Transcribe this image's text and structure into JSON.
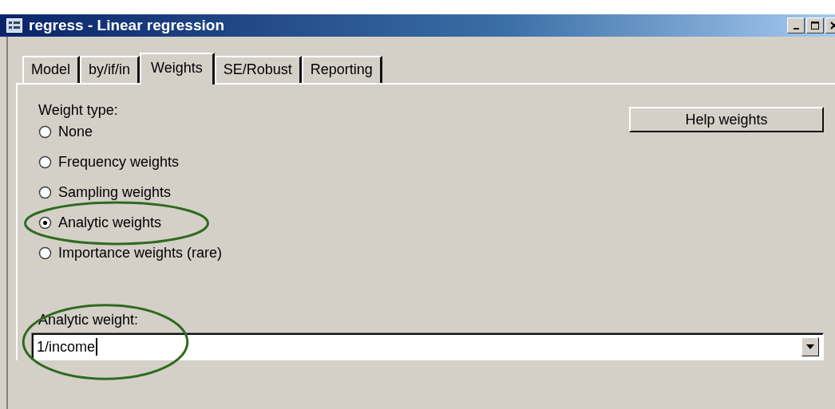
{
  "window": {
    "title": "regress - Linear regression"
  },
  "tabs": [
    {
      "label": "Model",
      "selected": false
    },
    {
      "label": "by/if/in",
      "selected": false
    },
    {
      "label": "Weights",
      "selected": true
    },
    {
      "label": "SE/Robust",
      "selected": false
    },
    {
      "label": "Reporting",
      "selected": false
    }
  ],
  "help_button": {
    "label": "Help weights"
  },
  "weight_type": {
    "label": "Weight type:",
    "options": [
      {
        "label": "None",
        "selected": false,
        "circled": false
      },
      {
        "label": "Frequency weights",
        "selected": false,
        "circled": false
      },
      {
        "label": "Sampling weights",
        "selected": false,
        "circled": false
      },
      {
        "label": "Analytic weights",
        "selected": true,
        "circled": true
      },
      {
        "label": "Importance weights (rare)",
        "selected": false,
        "circled": false
      }
    ]
  },
  "weight_field": {
    "label": "Analytic weight:",
    "value": "1/income",
    "circled": true
  }
}
